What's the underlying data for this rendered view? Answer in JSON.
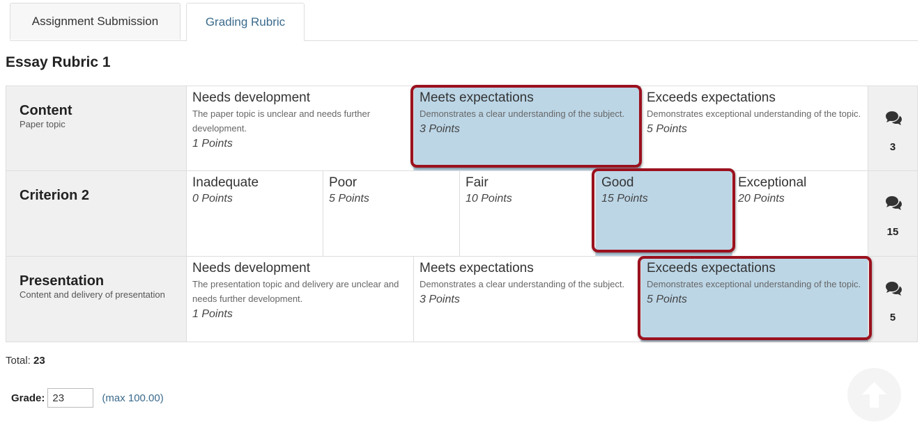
{
  "tabs": [
    {
      "label": "Assignment Submission"
    },
    {
      "label": "Grading Rubric"
    }
  ],
  "rubric": {
    "title": "Essay Rubric 1",
    "rows": [
      {
        "name": "Content",
        "desc": "Paper topic",
        "score": "3",
        "levels": [
          {
            "name": "Needs development",
            "desc": "The paper topic is unclear and needs further development.",
            "points": "1 Points"
          },
          {
            "name": "Meets expectations",
            "desc": "Demonstrates a clear understanding of the subject.",
            "points": "3 Points"
          },
          {
            "name": "Exceeds expectations",
            "desc": "Demonstrates exceptional understanding of the topic.",
            "points": "5 Points"
          }
        ]
      },
      {
        "name": "Criterion 2",
        "desc": "",
        "score": "15",
        "levels": [
          {
            "name": "Inadequate",
            "points": "0 Points"
          },
          {
            "name": "Poor",
            "points": "5 Points"
          },
          {
            "name": "Fair",
            "points": "10 Points"
          },
          {
            "name": "Good",
            "points": "15 Points"
          },
          {
            "name": "Exceptional",
            "points": "20 Points"
          }
        ]
      },
      {
        "name": "Presentation",
        "desc": "Content and delivery of presentation",
        "score": "5",
        "levels": [
          {
            "name": "Needs development",
            "desc": "The presentation topic and delivery are unclear and needs further development.",
            "points": "1 Points"
          },
          {
            "name": "Meets expectations",
            "desc": "Demonstrates a clear understanding of the subject.",
            "points": "3 Points"
          },
          {
            "name": "Exceeds expectations",
            "desc": "Demonstrates exceptional understanding of the topic.",
            "points": "5 Points"
          }
        ]
      }
    ]
  },
  "total": {
    "label": "Total:",
    "value": "23"
  },
  "grade": {
    "label": "Grade:",
    "value": "23",
    "max": "(max 100.00)"
  },
  "icons": {
    "comment": "comment-icon",
    "back_to_top": "arrow-up-icon"
  },
  "colors": {
    "selected": "#bcd6e6",
    "highlight": "#9b111e",
    "link": "#3a6a8c"
  }
}
